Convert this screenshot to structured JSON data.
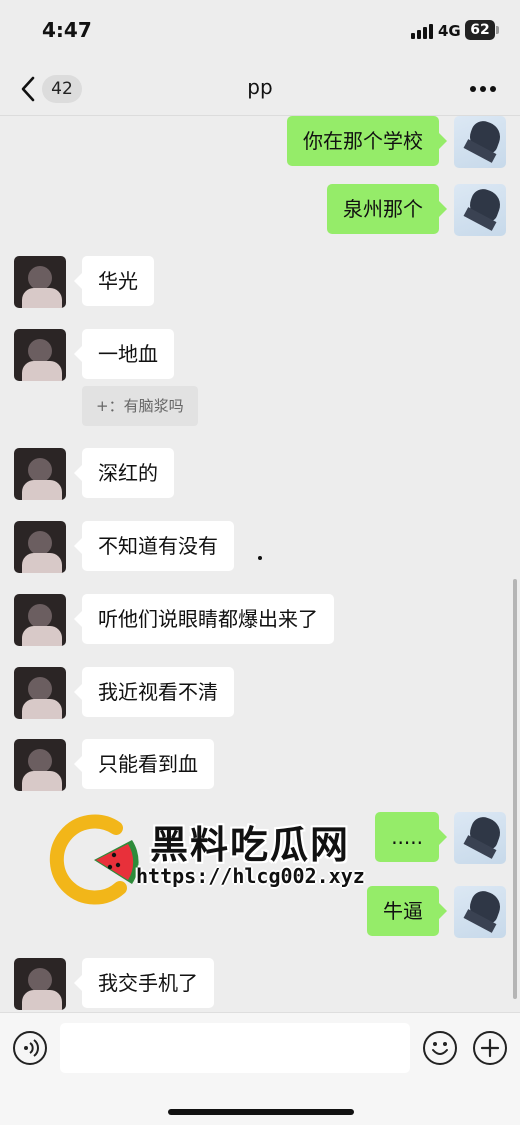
{
  "status_bar": {
    "time": "4:47",
    "network": "4G",
    "battery": "62"
  },
  "header": {
    "back_icon": "chevron-left-icon",
    "unread_count": "42",
    "title": "pp",
    "more_icon": "more-dots-icon"
  },
  "messages": [
    {
      "side": "right",
      "text": "你在那个学校"
    },
    {
      "side": "right",
      "text": "泉州那个"
    },
    {
      "side": "left",
      "text": "华光"
    },
    {
      "side": "left",
      "text": "一地血",
      "quote": "+：有脑浆吗"
    },
    {
      "side": "left",
      "text": "深红的"
    },
    {
      "side": "left",
      "text": "不知道有没有"
    },
    {
      "side": "left",
      "text": "听他们说眼睛都爆出来了"
    },
    {
      "side": "left",
      "text": "我近视看不清"
    },
    {
      "side": "left",
      "text": "只能看到血"
    },
    {
      "side": "right",
      "text": "....."
    },
    {
      "side": "right",
      "text": "牛逼"
    },
    {
      "side": "left",
      "text": "我交手机了"
    }
  ],
  "watermark": {
    "name": "黑料吃瓜网",
    "url": "https://hlcg002.xyz",
    "accent": "#f2b619",
    "logo_icon": "watermelon-logo-icon"
  },
  "input_bar": {
    "voice_icon": "voice-icon",
    "input_value": "",
    "emoji_icon": "emoji-icon",
    "add_icon": "plus-icon"
  },
  "colors": {
    "background": "#ededed",
    "bubble_mine": "#95ec69",
    "bubble_theirs": "#ffffff"
  }
}
